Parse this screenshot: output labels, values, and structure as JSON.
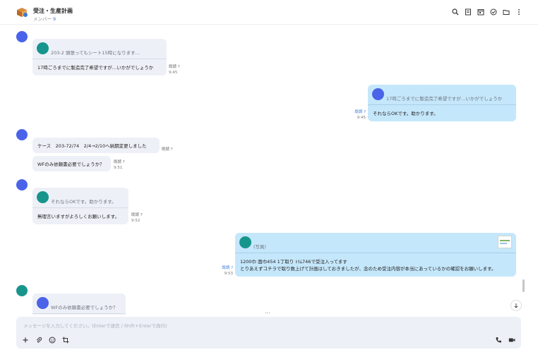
{
  "header": {
    "title": "受注・生産計画",
    "members_label": "メンバー",
    "members_count": "9"
  },
  "messages": {
    "m1": {
      "quote": "203-2 頭張ってもシート15時になります…",
      "text": "17時ごろまでに製造完了希望ですが…いかがでしょうか",
      "read": "既読 ?",
      "time": "9:45"
    },
    "m2": {
      "quote": "17時ごろまでに製造完了希望ですが…いかがでしょうか",
      "text": "それならOKです。助かります。",
      "read": "既読 ?",
      "time": "9:45"
    },
    "m3": {
      "text": "ケース　203-72/74　2/4→2/10へ納期変更しました",
      "read": "既読 ?"
    },
    "m4": {
      "text": "WFのみ依頼書必要でしょうか？",
      "read": "既読 ?",
      "time": "9:51"
    },
    "m5": {
      "quote": "それならOKです。助かります。",
      "text": "無理言いますがよろしくお願いします。",
      "read": "既読 ?",
      "time": "9:52"
    },
    "m6": {
      "quote": "(写真)",
      "line1": "1200巾 面巾454 1丁取り ﾄﾘﾑ746で受注入ってます",
      "line2": "とりあえずコチラで取り数上げて計画はしておきましたが、念のため受注内容が本当にあっているかの確認をお願いします。",
      "read": "既読 ?",
      "time": "9:53"
    },
    "m7": {
      "quote": "WFのみ依頼書必要でしょうか？"
    }
  },
  "ellipsis": "…",
  "composer": {
    "placeholder": "メッセージを入力してください。(Enterで送信 / Shift＋Enterで改行)"
  },
  "icons": {
    "header": [
      "search-icon",
      "note-icon",
      "calendar-icon",
      "task-icon",
      "folder-icon",
      "more-vertical-icon"
    ],
    "composer_left": [
      "plus-icon",
      "attach-icon",
      "emoji-icon",
      "crop-icon"
    ],
    "composer_right": [
      "phone-icon",
      "video-icon"
    ]
  },
  "colors": {
    "incoming_bubble": "#eef0f7",
    "outgoing_bubble": "#c5e7fb",
    "avatar_blue": "#4a63e8",
    "avatar_teal": "#17958c",
    "read_link": "#3a7bd5"
  }
}
